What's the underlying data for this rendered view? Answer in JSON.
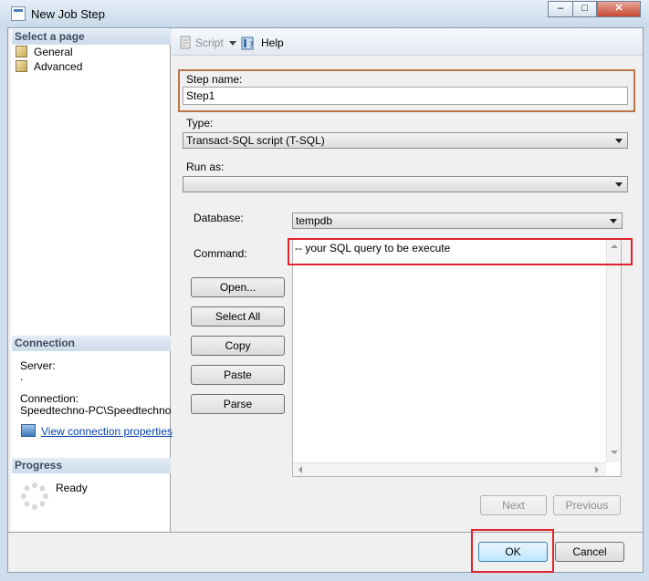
{
  "window": {
    "title": "New Job Step",
    "controls": {
      "minimize": "–",
      "maximize": "□",
      "close": "✕"
    }
  },
  "left_pane": {
    "select_page_header": "Select a page",
    "pages": [
      {
        "label": "General",
        "icon": "page-icon"
      },
      {
        "label": "Advanced",
        "icon": "page-icon"
      }
    ],
    "connection_header": "Connection",
    "server_label": "Server:",
    "server_value": ".",
    "connection_label": "Connection:",
    "connection_value": "Speedtechno-PC\\Speedtechno",
    "view_connection_link": "View connection properties",
    "progress_header": "Progress",
    "progress_status": "Ready"
  },
  "toolbar": {
    "script_label": "Script",
    "help_label": "Help"
  },
  "form": {
    "step_name_label": "Step name:",
    "step_name_value": "Step1",
    "type_label": "Type:",
    "type_value": "Transact-SQL script (T-SQL)",
    "run_as_label": "Run as:",
    "run_as_value": "",
    "database_label": "Database:",
    "database_value": "tempdb",
    "command_label": "Command:",
    "command_value": "-- your SQL query to be execute"
  },
  "side_buttons": {
    "open": "Open...",
    "select_all": "Select All",
    "copy": "Copy",
    "paste": "Paste",
    "parse": "Parse"
  },
  "nav_buttons": {
    "next": "Next",
    "previous": "Previous"
  },
  "dialog_buttons": {
    "ok": "OK",
    "cancel": "Cancel"
  },
  "colors": {
    "highlight_red": "#e0242e",
    "highlight_brown": "#b9754a",
    "section_header": "#cddbeb",
    "link": "#0645ad"
  }
}
